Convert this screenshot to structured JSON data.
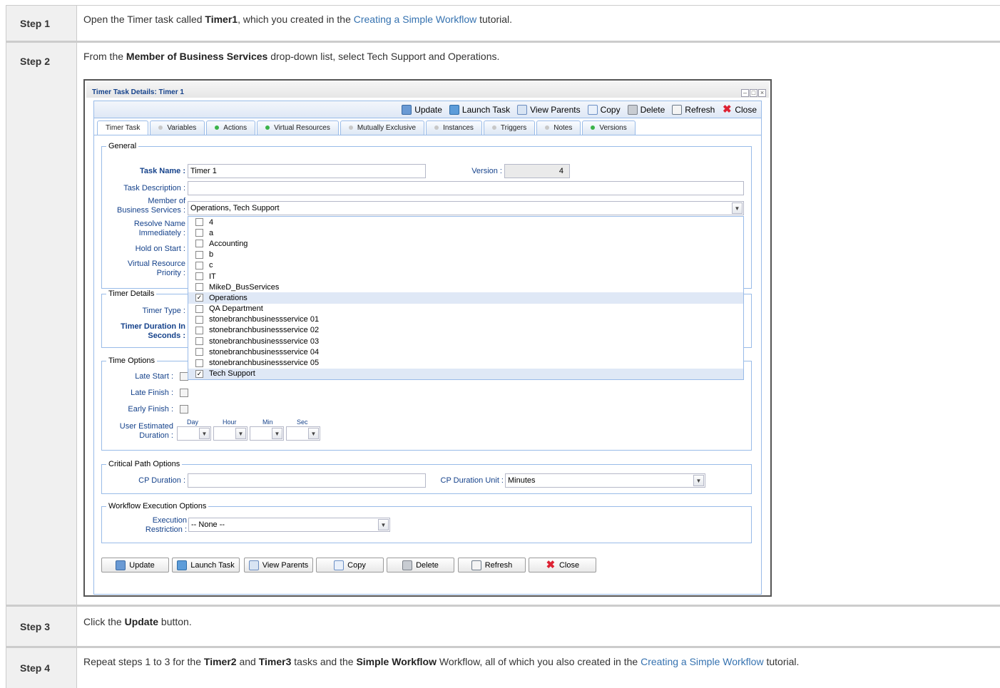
{
  "steps": [
    {
      "label": "Step 1",
      "pre": "Open the Timer task called ",
      "b1": "Timer1",
      "mid": ", which you created in the ",
      "link": "Creating a Simple Workflow",
      "post": " tutorial."
    },
    {
      "label": "Step 2",
      "pre": "From the ",
      "b1": "Member of Business Services",
      "post": " drop-down list, select Tech Support and Operations."
    },
    {
      "label": "Step 3",
      "pre": "Click the ",
      "b1": "Update",
      "post": " button."
    },
    {
      "label": "Step 4",
      "pre": "Repeat steps 1 to 3 for the ",
      "b1": "Timer2",
      "and": " and ",
      "b2": "Timer3",
      "mid": " tasks and the ",
      "b3": "Simple Workflow",
      "mid2": " Workflow, all of which you also created in the ",
      "link": "Creating a Simple Workflow",
      "post": " tutorial."
    }
  ],
  "window": {
    "title": "Timer Task Details: Timer 1",
    "controls": [
      "–",
      "□",
      "×"
    ],
    "toolbar": {
      "update": "Update",
      "launch": "Launch Task",
      "parents": "View Parents",
      "copy": "Copy",
      "delete": "Delete",
      "refresh": "Refresh",
      "close": "Close"
    },
    "tabs": [
      {
        "label": "Timer Task",
        "dot": "none"
      },
      {
        "label": "Variables",
        "dot": "grey"
      },
      {
        "label": "Actions",
        "dot": "green"
      },
      {
        "label": "Virtual Resources",
        "dot": "green"
      },
      {
        "label": "Mutually Exclusive",
        "dot": "grey"
      },
      {
        "label": "Instances",
        "dot": "grey"
      },
      {
        "label": "Triggers",
        "dot": "grey"
      },
      {
        "label": "Notes",
        "dot": "grey"
      },
      {
        "label": "Versions",
        "dot": "green"
      }
    ],
    "general": {
      "legend": "General",
      "task_name_label": "Task Name :",
      "task_name": "Timer 1",
      "version_label": "Version :",
      "version": "4",
      "desc_label": "Task Description :",
      "member_label1": "Member of",
      "member_label2": "Business Services :",
      "member_value": "Operations, Tech Support",
      "resolve_label1": "Resolve Name",
      "resolve_label2": "Immediately :",
      "hold_label": "Hold on Start :",
      "vr_label1": "Virtual Resource",
      "vr_label2": "Priority :"
    },
    "dropdown_options": [
      {
        "label": "4",
        "checked": false
      },
      {
        "label": "a",
        "checked": false
      },
      {
        "label": "Accounting",
        "checked": false
      },
      {
        "label": "b",
        "checked": false
      },
      {
        "label": "c",
        "checked": false
      },
      {
        "label": "IT",
        "checked": false
      },
      {
        "label": "MikeD_BusServices",
        "checked": false
      },
      {
        "label": "Operations",
        "checked": true
      },
      {
        "label": "QA Department",
        "checked": false
      },
      {
        "label": "stonebranchbusinessservice 01",
        "checked": false
      },
      {
        "label": "stonebranchbusinessservice 02",
        "checked": false
      },
      {
        "label": "stonebranchbusinessservice 03",
        "checked": false
      },
      {
        "label": "stonebranchbusinessservice 04",
        "checked": false
      },
      {
        "label": "stonebranchbusinessservice 05",
        "checked": false
      },
      {
        "label": "Tech Support",
        "checked": true
      }
    ],
    "timer_details": {
      "legend": "Timer Details",
      "type_label": "Timer Type :",
      "dur_label1": "Timer Duration In",
      "dur_label2": "Seconds :"
    },
    "time_options": {
      "legend": "Time Options",
      "late_start": "Late Start :",
      "late_finish": "Late Finish :",
      "early_finish": "Early Finish :",
      "ued_label1": "User Estimated",
      "ued_label2": "Duration :",
      "day": "Day",
      "hour": "Hour",
      "min": "Min",
      "sec": "Sec"
    },
    "critical_path": {
      "legend": "Critical Path Options",
      "cp_label": "CP Duration :",
      "unit_label": "CP Duration Unit :",
      "unit_value": "Minutes"
    },
    "workflow_exec": {
      "legend": "Workflow Execution Options",
      "label1": "Execution",
      "label2": "Restriction :",
      "value": "-- None --"
    },
    "bottom_buttons": {
      "update": "Update",
      "launch": "Launch Task",
      "parents": "View Parents",
      "copy": "Copy",
      "delete": "Delete",
      "refresh": "Refresh",
      "close": "Close"
    }
  }
}
